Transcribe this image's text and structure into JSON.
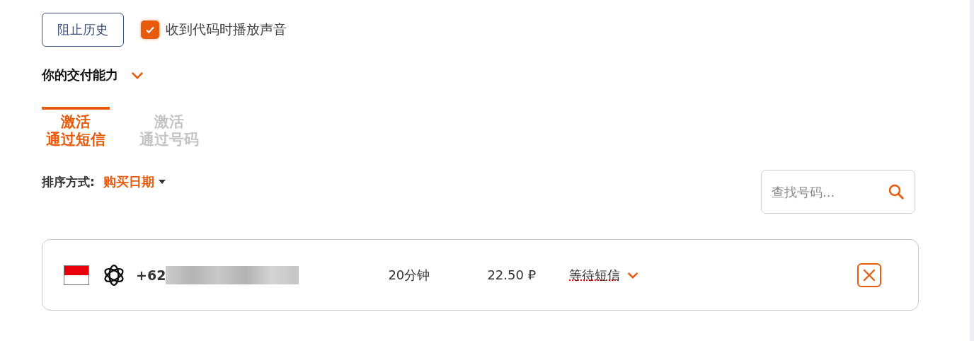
{
  "history_button": {
    "label": "阻止历史"
  },
  "sound_option": {
    "label": "收到代码时播放声音",
    "checked": true
  },
  "capabilities": {
    "label": "你的交付能力",
    "expanded": false
  },
  "tabs": [
    {
      "line1": "激活",
      "line2": "通过短信",
      "selected": true
    },
    {
      "line1": "激活",
      "line2": "通过号码",
      "selected": false
    }
  ],
  "sort": {
    "label": "排序方式:",
    "value": "购买日期"
  },
  "search": {
    "placeholder": "查找号码..."
  },
  "orders": [
    {
      "phone_prefix": "+62",
      "phone_redacted": true,
      "duration": "20分钟",
      "price": "22.50 ₽",
      "status": "等待短信"
    }
  ]
}
